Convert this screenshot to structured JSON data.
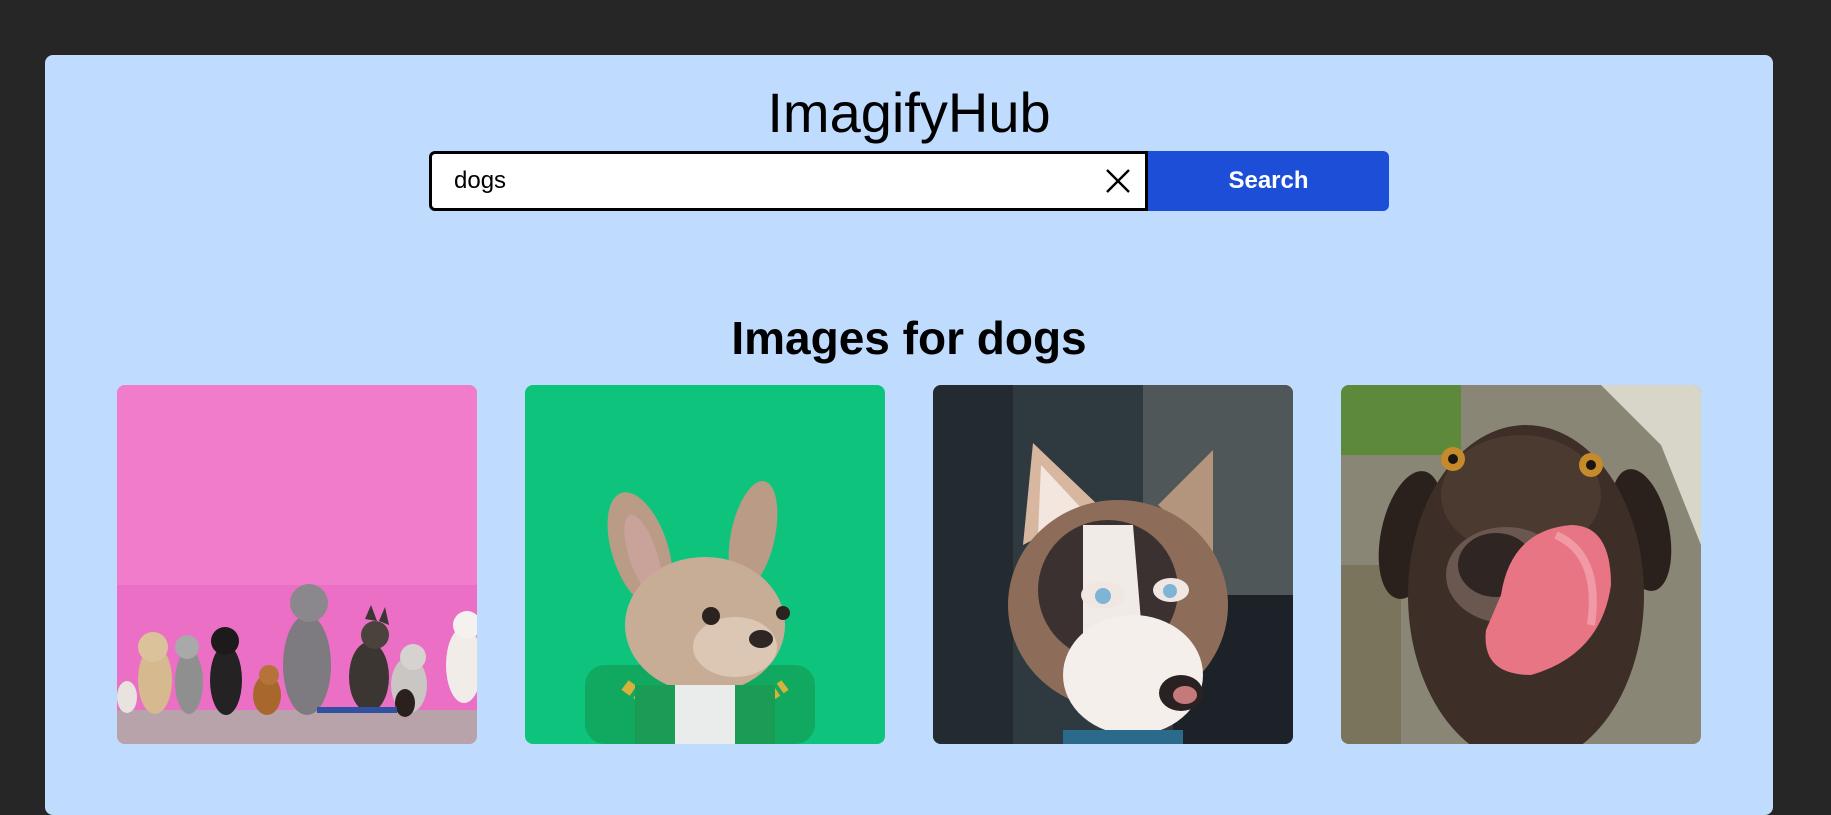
{
  "header": {
    "title": "ImagifyHub"
  },
  "search": {
    "value": "dogs",
    "button_label": "Search",
    "clear_icon": "close-icon"
  },
  "results": {
    "heading": "Images for dogs",
    "images": [
      {
        "subject": "group of dogs sitting against a pink wall",
        "background": "#ec6fc6"
      },
      {
        "subject": "french bulldog with gold chain on green background",
        "background": "#0ec47c"
      },
      {
        "subject": "siberian husky with blue eyes",
        "background": "#2f3a40"
      },
      {
        "subject": "chocolate labrador licking its nose",
        "background": "#6b6a5c"
      }
    ]
  },
  "colors": {
    "page_background": "#262626",
    "card_background": "#bfdbfe",
    "accent": "#1d4ed8"
  }
}
